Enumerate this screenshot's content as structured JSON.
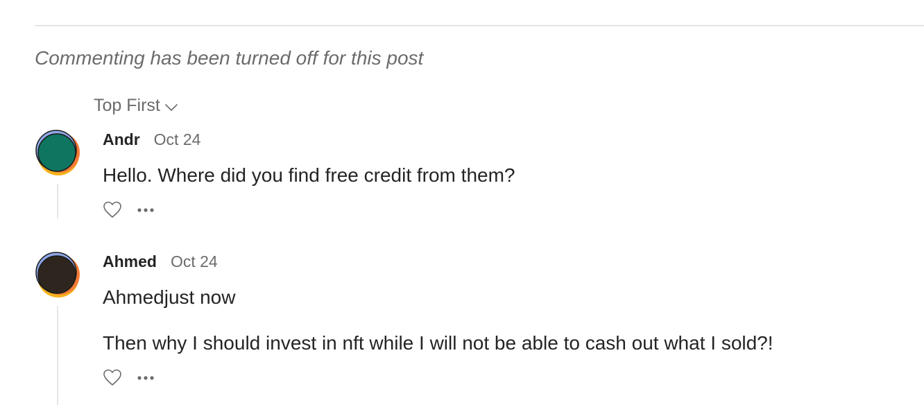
{
  "notice": "Commenting has been turned off for this post",
  "sort": {
    "label": "Top First",
    "icon": "chevron-down-icon"
  },
  "comments": [
    {
      "author": "Andr",
      "date": "Oct 24",
      "body": [
        "Hello. Where did you find free credit from them?"
      ],
      "avatar_fill": "#0e7560"
    },
    {
      "author": "Ahmed",
      "date": "Oct 24",
      "body": [
        "Ahmedjust now",
        "Then why I should invest in nft while I will not be able to cash out what I sold?!"
      ],
      "avatar_fill": "#2e261e"
    }
  ],
  "icons": {
    "like": "heart-icon",
    "more": "more-dots-icon"
  },
  "colors": {
    "text_primary": "#242424",
    "text_secondary": "#6b6b6b",
    "divider": "#e6e6e6",
    "avatar_ring_blue": "#8ea6e6",
    "avatar_ring_orange": "#f47b36",
    "avatar_ring_yellow": "#f5b21f"
  }
}
